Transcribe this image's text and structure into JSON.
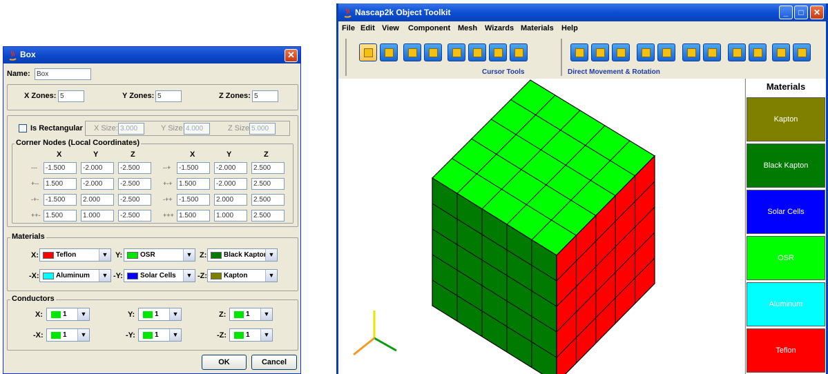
{
  "box_dialog": {
    "title": "Box",
    "close_label": "✕",
    "name_label": "Name:",
    "name_value": "Box",
    "x_zones_label": "X Zones:",
    "x_zones_value": "5",
    "y_zones_label": "Y Zones:",
    "y_zones_value": "5",
    "z_zones_label": "Z Zones:",
    "z_zones_value": "5",
    "is_rectangular_label": "Is Rectangular",
    "x_size_label": "X Size:",
    "x_size_value": "3.000",
    "y_size_label": "Y Size:",
    "y_size_value": "4.000",
    "z_size_label": "Z Size:",
    "z_size_value": "5.000",
    "corner_nodes_title": "Corner Nodes (Local Coordinates)",
    "col_x": "X",
    "col_y": "Y",
    "col_z": "Z",
    "corner_rows": [
      {
        "left_sign": "---",
        "lx": "-1.500",
        "ly": "-2.000",
        "lz": "-2.500",
        "right_sign": "--+",
        "rx": "-1.500",
        "ry": "-2.000",
        "rz": "2.500"
      },
      {
        "left_sign": "+--",
        "lx": "1.500",
        "ly": "-2.000",
        "lz": "-2.500",
        "right_sign": "+-+",
        "rx": "1.500",
        "ry": "-2.000",
        "rz": "2.500"
      },
      {
        "left_sign": "-+-",
        "lx": "-1.500",
        "ly": "2.000",
        "lz": "-2.500",
        "right_sign": "-++",
        "rx": "-1.500",
        "ry": "2.000",
        "rz": "2.500"
      },
      {
        "left_sign": "++-",
        "lx": "1.500",
        "ly": "1.000",
        "lz": "-2.500",
        "right_sign": "+++",
        "rx": "1.500",
        "ry": "1.000",
        "rz": "2.500"
      }
    ],
    "materials_title": "Materials",
    "materials": {
      "px_label": "X:",
      "px_value": "Teflon",
      "px_color": "#ff0000",
      "py_label": "Y:",
      "py_value": "OSR",
      "py_color": "#00e600",
      "pz_label": "Z:",
      "pz_value": "Black Kapton",
      "pz_color": "#007a00",
      "nx_label": "-X:",
      "nx_value": "Aluminum",
      "nx_color": "#00ffff",
      "ny_label": "-Y:",
      "ny_value": "Solar Cells",
      "ny_color": "#0000ff",
      "nz_label": "-Z:",
      "nz_value": "Kapton",
      "nz_color": "#808000"
    },
    "conductors_title": "Conductors",
    "conductors": {
      "px_label": "X:",
      "px_value": "1",
      "py_label": "Y:",
      "py_value": "1",
      "pz_label": "Z:",
      "pz_value": "1",
      "nx_label": "-X:",
      "nx_value": "1",
      "ny_label": "-Y:",
      "ny_value": "1",
      "nz_label": "-Z:",
      "nz_value": "1",
      "color": "#00e600"
    },
    "ok_label": "OK",
    "cancel_label": "Cancel"
  },
  "toolkit": {
    "title": "Nascap2k Object Toolkit",
    "min_label": "_",
    "max_label": "□",
    "close_label": "✕",
    "menu": [
      "File",
      "Edit",
      "View",
      "Component",
      "Mesh",
      "Wizards",
      "Materials",
      "Help"
    ],
    "cursor_tools_label": "Cursor Tools",
    "movement_label": "Direct Movement & Rotation",
    "materials_header": "Materials",
    "materials": [
      {
        "name": "Kapton",
        "color": "#808000",
        "text_color": "#ffffff"
      },
      {
        "name": "Black Kapton",
        "color": "#007a00",
        "text_color": "#ffffff"
      },
      {
        "name": "Solar Cells",
        "color": "#0000ff",
        "text_color": "#ffffff"
      },
      {
        "name": "OSR",
        "color": "#00ff00",
        "text_color": "#ffffff"
      },
      {
        "name": "Aluminum",
        "color": "#00ffff",
        "text_color": "#ffffff"
      },
      {
        "name": "Teflon",
        "color": "#ff0000",
        "text_color": "#ffffff"
      }
    ],
    "cube": {
      "top_color": "#00ff00",
      "left_color": "#007a00",
      "right_color": "#ff0000",
      "zones": 5
    }
  }
}
